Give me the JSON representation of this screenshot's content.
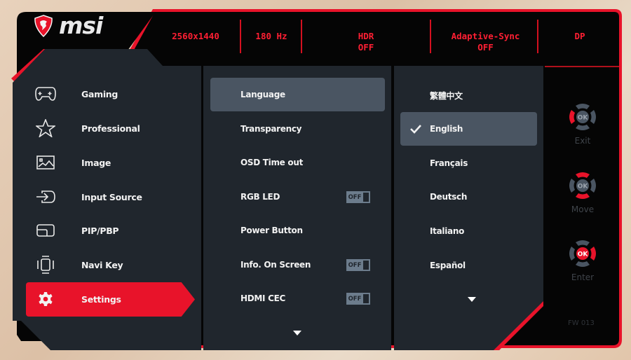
{
  "brand": {
    "logo_text": "msi"
  },
  "header": {
    "items": [
      {
        "label": "2560x1440",
        "value": ""
      },
      {
        "label": "180 Hz",
        "value": ""
      },
      {
        "label": "HDR",
        "value": "OFF"
      },
      {
        "label": "Adaptive-Sync",
        "value": "OFF"
      },
      {
        "label": "DP",
        "value": ""
      }
    ]
  },
  "sidebar": {
    "items": [
      {
        "label": "Gaming",
        "icon": "gamepad-icon",
        "selected": false
      },
      {
        "label": "Professional",
        "icon": "star-icon",
        "selected": false
      },
      {
        "label": "Image",
        "icon": "image-icon",
        "selected": false
      },
      {
        "label": "Input Source",
        "icon": "input-source-icon",
        "selected": false
      },
      {
        "label": "PIP/PBP",
        "icon": "pip-icon",
        "selected": false
      },
      {
        "label": "Navi Key",
        "icon": "navi-key-icon",
        "selected": false
      },
      {
        "label": "Settings",
        "icon": "gear-icon",
        "selected": true
      }
    ]
  },
  "settings": {
    "items": [
      {
        "label": "Language",
        "toggle": null,
        "highlighted": true
      },
      {
        "label": "Transparency",
        "toggle": null,
        "highlighted": false
      },
      {
        "label": "OSD Time out",
        "toggle": null,
        "highlighted": false
      },
      {
        "label": "RGB LED",
        "toggle": "OFF",
        "highlighted": false
      },
      {
        "label": "Power Button",
        "toggle": null,
        "highlighted": false
      },
      {
        "label": "Info. On Screen",
        "toggle": "OFF",
        "highlighted": false
      },
      {
        "label": "HDMI CEC",
        "toggle": "OFF",
        "highlighted": false
      }
    ],
    "more_icon": "chevron-down-icon"
  },
  "languages": {
    "items": [
      {
        "label": "繁體中文",
        "checked": false
      },
      {
        "label": "English",
        "checked": true
      },
      {
        "label": "Français",
        "checked": false
      },
      {
        "label": "Deutsch",
        "checked": false
      },
      {
        "label": "Italiano",
        "checked": false
      },
      {
        "label": "Español",
        "checked": false
      }
    ],
    "more_icon": "chevron-down-icon"
  },
  "navi_hints": [
    {
      "label": "Exit",
      "active_direction": "left",
      "ok_active": false
    },
    {
      "label": "Move",
      "active_direction": "up-down",
      "ok_active": false
    },
    {
      "label": "Enter",
      "active_direction": "right",
      "ok_active": true
    }
  ],
  "navi_ok_label": "OK",
  "firmware": "FW 013",
  "colors": {
    "accent": "#e8132a",
    "panel": "#20262d",
    "frame": "#050505",
    "highlight": "#4a5562"
  }
}
